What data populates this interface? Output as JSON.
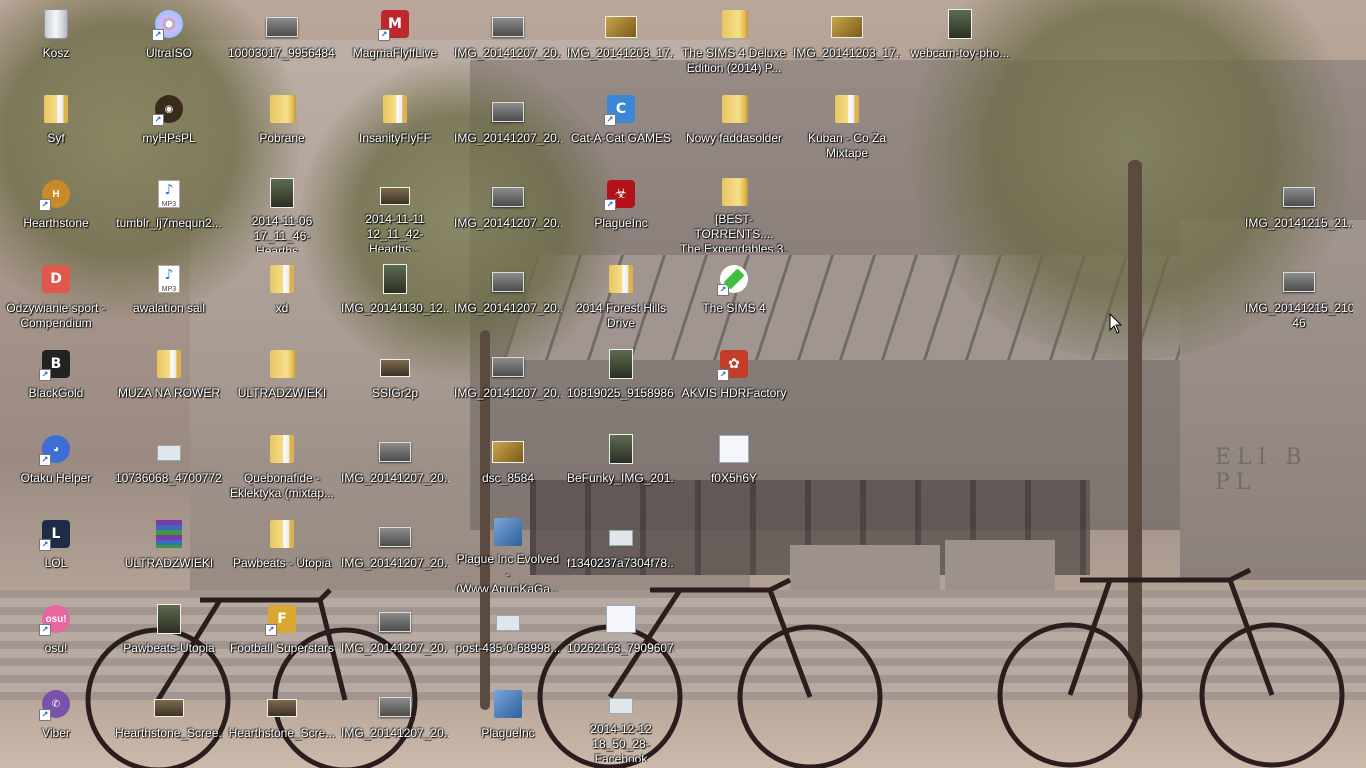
{
  "desktop": {
    "icons": [
      {
        "label": "Kosz",
        "icon": "recycle-bin-icon",
        "kind": "recycle",
        "col": 0,
        "row": 0
      },
      {
        "label": "Syf",
        "icon": "folder-icon",
        "kind": "folderdoc",
        "col": 0,
        "row": 1
      },
      {
        "label": "Hearthstone",
        "icon": "hearthstone-icon",
        "kind": "round",
        "color": "#c98a2a",
        "glyph": "H",
        "col": 0,
        "row": 2,
        "shortcut": true
      },
      {
        "label": "Odzywianie sport -\nCompendium",
        "icon": "pdf-document-icon",
        "kind": "app",
        "color": "#e2574c",
        "glyph": "D",
        "col": 0,
        "row": 3
      },
      {
        "label": "BlackGold",
        "icon": "blackgold-game-icon",
        "kind": "app",
        "color": "#222222",
        "glyph": "B",
        "col": 0,
        "row": 4,
        "shortcut": true
      },
      {
        "label": "Otaku Helper",
        "icon": "otaku-helper-icon",
        "kind": "round",
        "color": "#3b6fd6",
        "glyph": "◕",
        "col": 0,
        "row": 5,
        "shortcut": true
      },
      {
        "label": "LOL",
        "icon": "league-of-legends-icon",
        "kind": "app",
        "color": "#1d2c47",
        "glyph": "L",
        "col": 0,
        "row": 6,
        "shortcut": true
      },
      {
        "label": "osu!",
        "icon": "osu-icon",
        "kind": "round",
        "color": "#e9669f",
        "glyph": "osu!",
        "col": 0,
        "row": 7,
        "shortcut": true
      },
      {
        "label": "Viber",
        "icon": "viber-icon",
        "kind": "round",
        "color": "#7b52ab",
        "glyph": "✆",
        "col": 0,
        "row": 8,
        "shortcut": true
      },
      {
        "label": "UltraISO",
        "icon": "disc-icon",
        "kind": "disc",
        "col": 1,
        "row": 0,
        "shortcut": true
      },
      {
        "label": "myHPsPL",
        "icon": "cauldron-icon",
        "kind": "round",
        "color": "#3a2a1a",
        "glyph": "◉",
        "col": 1,
        "row": 1,
        "shortcut": true
      },
      {
        "label": "tumblr_lj7mequn2...",
        "icon": "mp3-file-icon",
        "kind": "mp3",
        "col": 1,
        "row": 2
      },
      {
        "label": "awalation sail",
        "icon": "mp3-file-icon",
        "kind": "mp3",
        "col": 1,
        "row": 3
      },
      {
        "label": "MUZA NA ROWER",
        "icon": "folder-icon",
        "kind": "folderdoc",
        "col": 1,
        "row": 4
      },
      {
        "label": "10736068_4700772...",
        "icon": "image-file-icon",
        "kind": "txt",
        "col": 1,
        "row": 5
      },
      {
        "label": "ULTRADZWIEKI",
        "icon": "winrar-archive-icon",
        "kind": "rar",
        "col": 1,
        "row": 6
      },
      {
        "label": "Pawbeats-Utopia",
        "icon": "album-cover-icon",
        "kind": "photo-dark",
        "col": 1,
        "row": 7
      },
      {
        "label": "Hearthstone_Scree...",
        "icon": "image-file-icon",
        "kind": "photo-wide",
        "col": 1,
        "row": 8
      },
      {
        "label": "10003017_9956484...",
        "icon": "image-file-icon",
        "kind": "photo",
        "col": 2,
        "row": 0
      },
      {
        "label": "Pobrane",
        "icon": "folder-icon",
        "kind": "folder",
        "col": 2,
        "row": 1
      },
      {
        "label": "2014-11-06\n17_11_46-Hearths...",
        "icon": "image-file-icon",
        "kind": "photo-dark",
        "col": 2,
        "row": 2
      },
      {
        "label": "xd",
        "icon": "folder-icon",
        "kind": "folderdoc",
        "col": 2,
        "row": 3
      },
      {
        "label": "ULTRADZWIEKI",
        "icon": "folder-icon",
        "kind": "folder",
        "col": 2,
        "row": 4
      },
      {
        "label": "Quebonafide -\nEklektyka (mixtap...",
        "icon": "folder-icon",
        "kind": "folderdoc",
        "col": 2,
        "row": 5
      },
      {
        "label": "Pawbeats - Utopia",
        "icon": "folder-icon",
        "kind": "folderdoc",
        "col": 2,
        "row": 6
      },
      {
        "label": "Football Superstars",
        "icon": "football-superstars-icon",
        "kind": "app",
        "color": "#d9a630",
        "glyph": "F",
        "col": 2,
        "row": 7,
        "shortcut": true
      },
      {
        "label": "Hearthstone_Scre...",
        "icon": "image-file-icon",
        "kind": "photo-wide",
        "col": 2,
        "row": 8
      },
      {
        "label": "MagmaFlyffLive",
        "icon": "magma-flyff-icon",
        "kind": "app",
        "color": "#c0272d",
        "glyph": "M",
        "col": 3,
        "row": 0,
        "shortcut": true
      },
      {
        "label": "InsanityFlyFF",
        "icon": "folder-icon",
        "kind": "folderdoc",
        "col": 3,
        "row": 1
      },
      {
        "label": "2014-11-11\n12_11_42-Hearths...",
        "icon": "image-file-icon",
        "kind": "photo-wide",
        "col": 3,
        "row": 2
      },
      {
        "label": "IMG_20141130_12...",
        "icon": "image-file-icon",
        "kind": "photo-dark",
        "col": 3,
        "row": 3
      },
      {
        "label": "SSIGr2p",
        "icon": "image-file-icon",
        "kind": "photo-wide",
        "col": 3,
        "row": 4
      },
      {
        "label": "IMG_20141207_20...",
        "icon": "image-file-icon",
        "kind": "photo",
        "col": 3,
        "row": 5
      },
      {
        "label": "IMG_20141207_20...",
        "icon": "image-file-icon",
        "kind": "photo",
        "col": 3,
        "row": 6
      },
      {
        "label": "IMG_20141207_20...",
        "icon": "image-file-icon",
        "kind": "photo",
        "col": 3,
        "row": 7
      },
      {
        "label": "IMG_20141207_20...",
        "icon": "image-file-icon",
        "kind": "photo",
        "col": 3,
        "row": 8
      },
      {
        "label": "IMG_20141207_20...",
        "icon": "image-file-icon",
        "kind": "photo",
        "col": 4,
        "row": 0
      },
      {
        "label": "IMG_20141207_20...",
        "icon": "image-file-icon",
        "kind": "photo",
        "col": 4,
        "row": 1
      },
      {
        "label": "IMG_20141207_20...",
        "icon": "image-file-icon",
        "kind": "photo",
        "col": 4,
        "row": 2
      },
      {
        "label": "IMG_20141207_20...",
        "icon": "image-file-icon",
        "kind": "photo",
        "col": 4,
        "row": 3
      },
      {
        "label": "IMG_20141207_20...",
        "icon": "image-file-icon",
        "kind": "photo",
        "col": 4,
        "row": 4
      },
      {
        "label": "dsc_8584",
        "icon": "image-file-icon",
        "kind": "photo-warm",
        "col": 4,
        "row": 5
      },
      {
        "label": "Plague Inc Evolved -\n(Www.ApunKaGa...",
        "icon": "setup-installer-icon",
        "kind": "setup",
        "col": 4,
        "row": 6
      },
      {
        "label": "post-435-0-68998...",
        "icon": "image-file-icon",
        "kind": "txt",
        "col": 4,
        "row": 7
      },
      {
        "label": "PlagueInc",
        "icon": "plague-inc-setup-icon",
        "kind": "setup",
        "col": 4,
        "row": 8
      },
      {
        "label": "IMG_20141203_17...",
        "icon": "image-file-icon",
        "kind": "photo-warm",
        "col": 5,
        "row": 0
      },
      {
        "label": "Cat-A-Cat GAMES",
        "icon": "cat-a-cat-icon",
        "kind": "app",
        "color": "#3b86d6",
        "glyph": "C",
        "col": 5,
        "row": 1,
        "shortcut": true
      },
      {
        "label": "PlagueInc",
        "icon": "biohazard-icon",
        "kind": "app",
        "color": "#b3121a",
        "glyph": "☣",
        "col": 5,
        "row": 2,
        "shortcut": true
      },
      {
        "label": "2014 Forest Hills\nDrive",
        "icon": "folder-icon",
        "kind": "folderdoc",
        "col": 5,
        "row": 3
      },
      {
        "label": "10819025_9158986...",
        "icon": "image-file-icon",
        "kind": "photo-dark",
        "col": 5,
        "row": 4
      },
      {
        "label": "BeFunky_IMG_201...",
        "icon": "image-file-icon",
        "kind": "photo-dark",
        "col": 5,
        "row": 5
      },
      {
        "label": "f1340237a7304f78...",
        "icon": "image-file-icon",
        "kind": "txt",
        "col": 5,
        "row": 6
      },
      {
        "label": "10262163_7909607...",
        "icon": "image-file-icon",
        "kind": "web",
        "col": 5,
        "row": 7
      },
      {
        "label": "2014-12-12\n18_50_28-Facebook",
        "icon": "image-file-icon",
        "kind": "txt",
        "col": 5,
        "row": 8
      },
      {
        "label": "The SIMS 4 Deluxe\nEdition (2014) P...",
        "icon": "folder-icon",
        "kind": "folder",
        "col": 6,
        "row": 0
      },
      {
        "label": "Nowy faddasolder",
        "icon": "folder-icon",
        "kind": "folder",
        "col": 6,
        "row": 1
      },
      {
        "label": "[BEST-TORRENTS....\nThe.Expendables.3...",
        "icon": "folder-icon",
        "kind": "folder",
        "col": 6,
        "row": 2
      },
      {
        "label": "The SIMS 4",
        "icon": "sims-plumbob-icon",
        "kind": "sim",
        "col": 6,
        "row": 3,
        "shortcut": true
      },
      {
        "label": "AKVIS HDRFactory",
        "icon": "akvis-hdr-icon",
        "kind": "app",
        "color": "#c33c2a",
        "glyph": "✿",
        "col": 6,
        "row": 4,
        "shortcut": true
      },
      {
        "label": "f0X5h6Y",
        "icon": "image-file-icon",
        "kind": "web",
        "col": 6,
        "row": 5
      },
      {
        "label": "IMG_20141203_17...",
        "icon": "image-file-icon",
        "kind": "photo-warm",
        "col": 7,
        "row": 0
      },
      {
        "label": "Kuban - Co Za\nMixtape",
        "icon": "folder-icon",
        "kind": "folderdoc",
        "col": 7,
        "row": 1
      },
      {
        "label": "webcam-toy-pho...",
        "icon": "image-file-icon",
        "kind": "photo-dark",
        "col": 8,
        "row": 0
      },
      {
        "label": "IMG_20141215_21...",
        "icon": "image-file-icon",
        "kind": "photo",
        "col": 11,
        "row": 2
      },
      {
        "label": "IMG_20141215_2107\n46",
        "icon": "image-file-icon",
        "kind": "photo",
        "col": 11,
        "row": 3
      }
    ]
  }
}
